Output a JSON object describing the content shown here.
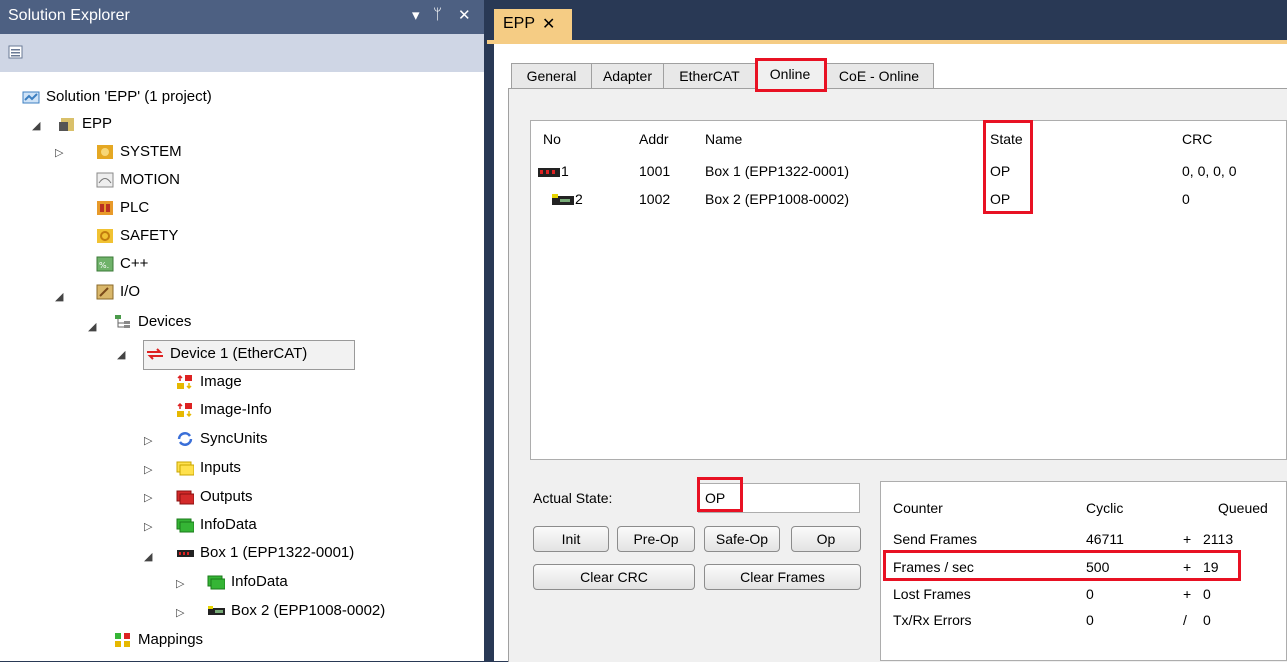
{
  "solution_explorer": {
    "title": "Solution Explorer",
    "pin_glyph": "▾ ⊥ ✕",
    "tree": [
      {
        "label": "Solution 'EPP' (1 project)",
        "icon": "solution-icon"
      },
      {
        "label": "EPP",
        "icon": "project-icon"
      },
      {
        "label": "SYSTEM",
        "icon": "system-icon"
      },
      {
        "label": "MOTION",
        "icon": "motion-icon"
      },
      {
        "label": "PLC",
        "icon": "plc-icon"
      },
      {
        "label": "SAFETY",
        "icon": "safety-icon"
      },
      {
        "label": "C++",
        "icon": "cpp-icon"
      },
      {
        "label": "I/O",
        "icon": "io-icon"
      },
      {
        "label": "Devices",
        "icon": "devices-icon"
      },
      {
        "label": "Device 1 (EtherCAT)",
        "icon": "ethercat-device-icon"
      },
      {
        "label": "Image",
        "icon": "image-icon"
      },
      {
        "label": "Image-Info",
        "icon": "image-info-icon"
      },
      {
        "label": "SyncUnits",
        "icon": "syncunits-icon"
      },
      {
        "label": "Inputs",
        "icon": "inputs-icon"
      },
      {
        "label": "Outputs",
        "icon": "outputs-icon"
      },
      {
        "label": "InfoData",
        "icon": "infodata-icon"
      },
      {
        "label": "Box 1 (EPP1322-0001)",
        "icon": "box-icon"
      },
      {
        "label": "InfoData",
        "icon": "infodata-icon"
      },
      {
        "label": "Box 2 (EPP1008-0002)",
        "icon": "box-icon"
      },
      {
        "label": "Mappings",
        "icon": "mappings-icon"
      }
    ]
  },
  "document": {
    "tab_title": "EPP",
    "tabs": [
      "General",
      "Adapter",
      "EtherCAT",
      "Online",
      "CoE - Online"
    ],
    "active_tab": "Online",
    "device_list": {
      "columns": [
        "No",
        "Addr",
        "Name",
        "State",
        "CRC"
      ],
      "rows": [
        {
          "no": "1",
          "addr": "1001",
          "name": "Box 1 (EPP1322-0001)",
          "state": "OP",
          "crc": "0, 0, 0, 0"
        },
        {
          "no": "2",
          "addr": "1002",
          "name": "Box 2 (EPP1008-0002)",
          "state": "OP",
          "crc": "0"
        }
      ]
    },
    "actual_state_label": "Actual State:",
    "actual_state_value": "OP",
    "buttons": {
      "init": "Init",
      "pre_op": "Pre-Op",
      "safe_op": "Safe-Op",
      "op": "Op",
      "clear_crc": "Clear CRC",
      "clear_frames": "Clear Frames"
    },
    "counters": {
      "columns": [
        "Counter",
        "Cyclic",
        "",
        "Queued"
      ],
      "rows": [
        {
          "counter": "Send Frames",
          "cyclic": "46711",
          "op": "+",
          "queued": "2113"
        },
        {
          "counter": "Frames / sec",
          "cyclic": "500",
          "op": "+",
          "queued": "19"
        },
        {
          "counter": "Lost Frames",
          "cyclic": "0",
          "op": "+",
          "queued": "0"
        },
        {
          "counter": "Tx/Rx Errors",
          "cyclic": "0",
          "op": "/",
          "queued": "0"
        }
      ]
    }
  },
  "colors": {
    "titlebar": "#4d6082",
    "doc_tab": "#f5cc84",
    "highlight": "#e81123",
    "background": "#293955"
  }
}
